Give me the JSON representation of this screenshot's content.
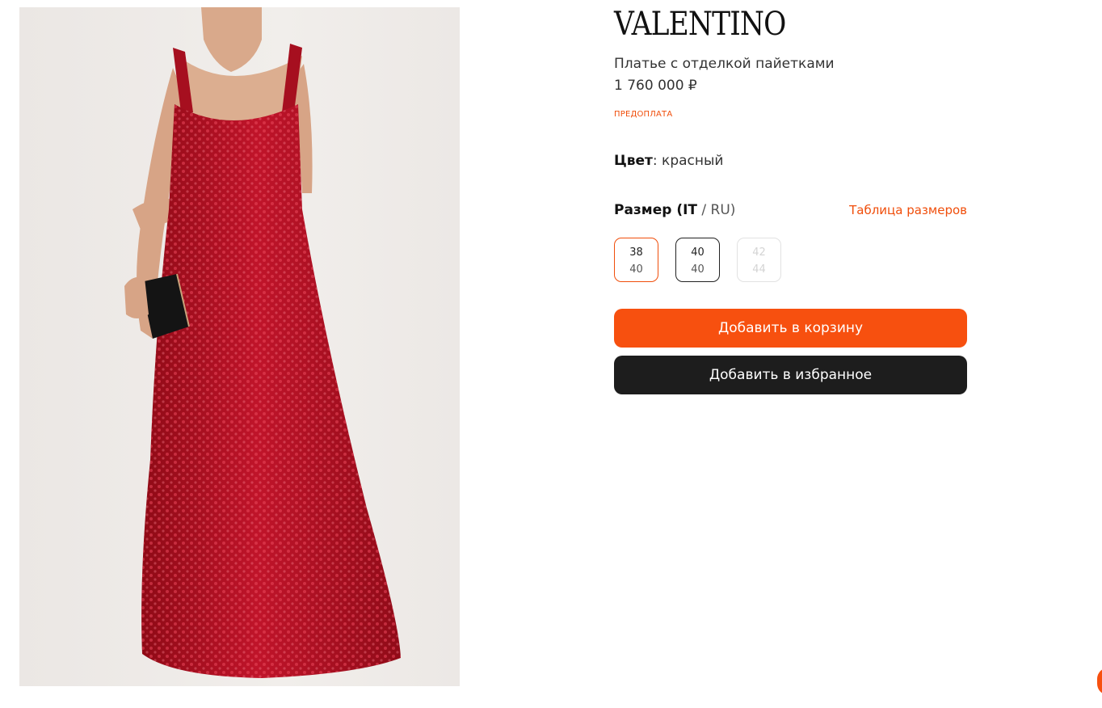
{
  "product": {
    "brand": "VALENTINO",
    "name": "Платье с отделкой пайетками",
    "price": "1 760 000 ₽",
    "prepayment_label": "ПРЕДОПЛАТА",
    "image_alt": "Платье с отделкой пайетками"
  },
  "color": {
    "label": "Цвет",
    "value": ": красный"
  },
  "size": {
    "title_bold": "Размер (IT",
    "title_rest": " / RU)",
    "table_link": "Таблица размеров",
    "options": [
      {
        "it": "38",
        "ru": "40",
        "state": "selected"
      },
      {
        "it": "40",
        "ru": "40",
        "state": "available"
      },
      {
        "it": "42",
        "ru": "44",
        "state": "unavailable"
      }
    ]
  },
  "actions": {
    "add_to_cart": "Добавить в корзину",
    "add_to_favorites": "Добавить в избранное"
  },
  "colors": {
    "accent": "#f7500f",
    "dark_button": "#1d1d1d",
    "dress_red": "#b5101e"
  }
}
